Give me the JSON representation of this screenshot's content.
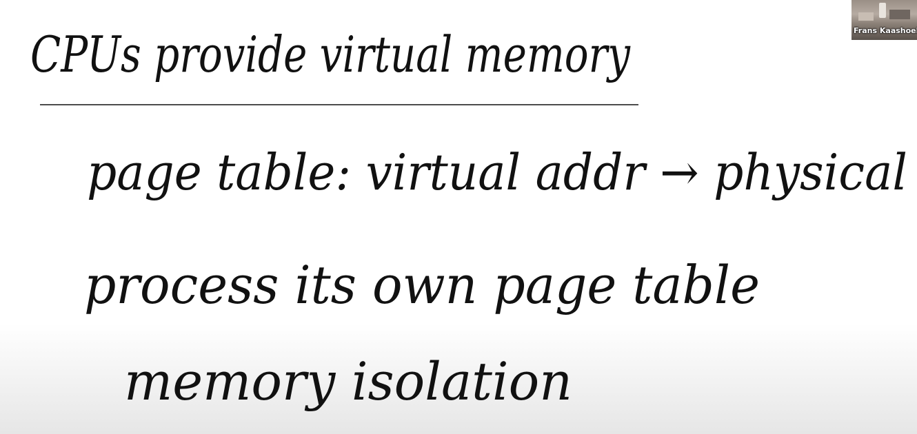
{
  "whiteboard": {
    "title": "CPUs provide virtual memory",
    "lines": [
      "page table:  virtual addr → physical",
      "process its own page table",
      "memory isolation"
    ]
  },
  "video": {
    "participant_name": "Frans Kaashoek"
  }
}
